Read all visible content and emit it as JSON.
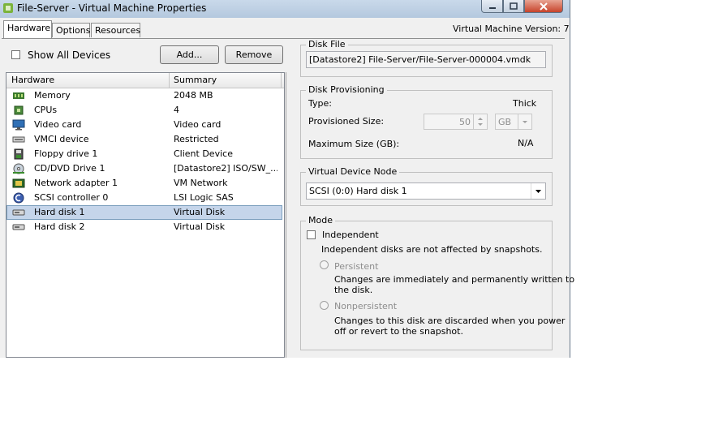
{
  "window": {
    "title": "File-Server - Virtual Machine Properties"
  },
  "tabs": [
    {
      "label": "Hardware",
      "active": true
    },
    {
      "label": "Options",
      "active": false
    },
    {
      "label": "Resources",
      "active": false
    }
  ],
  "vm_version": "Virtual Machine Version: 7",
  "show_all_devices": {
    "label": "Show All Devices",
    "checked": false
  },
  "buttons": {
    "add": "Add...",
    "remove": "Remove"
  },
  "hardware_table": {
    "columns": [
      "Hardware",
      "Summary"
    ],
    "rows": [
      {
        "name": "Memory",
        "summary": "2048 MB",
        "icon": "memory-icon"
      },
      {
        "name": "CPUs",
        "summary": "4",
        "icon": "cpu-icon"
      },
      {
        "name": "Video card",
        "summary": "Video card",
        "icon": "monitor-icon"
      },
      {
        "name": "VMCI device",
        "summary": "Restricted",
        "icon": "vmci-icon"
      },
      {
        "name": "Floppy drive 1",
        "summary": "Client Device",
        "icon": "floppy-icon"
      },
      {
        "name": "CD/DVD Drive 1",
        "summary": "[Datastore2] ISO/SW_...",
        "icon": "cd-icon"
      },
      {
        "name": "Network adapter 1",
        "summary": "VM Network",
        "icon": "network-icon"
      },
      {
        "name": "SCSI controller 0",
        "summary": "LSI Logic SAS",
        "icon": "scsi-icon"
      },
      {
        "name": "Hard disk 1",
        "summary": "Virtual Disk",
        "icon": "hard-disk-icon",
        "selected": true
      },
      {
        "name": "Hard disk 2",
        "summary": "Virtual Disk",
        "icon": "hard-disk-icon"
      }
    ]
  },
  "disk_file": {
    "label": "Disk File",
    "value": "[Datastore2] File-Server/File-Server-000004.vmdk"
  },
  "disk_provisioning": {
    "label": "Disk Provisioning",
    "type_label": "Type:",
    "type_value": "Thick",
    "provisioned_label": "Provisioned Size:",
    "provisioned_value": "50",
    "provisioned_unit": "GB",
    "max_label": "Maximum Size (GB):",
    "max_value": "N/A"
  },
  "virtual_device_node": {
    "label": "Virtual Device Node",
    "value": "SCSI (0:0) Hard disk 1"
  },
  "mode": {
    "label": "Mode",
    "independent_label": "Independent",
    "independent_checked": false,
    "independent_desc": "Independent disks are not affected by snapshots.",
    "persistent_label": "Persistent",
    "persistent_desc_1": "Changes are immediately and permanently written to",
    "persistent_desc_2": "the disk.",
    "nonpersistent_label": "Nonpersistent",
    "nonpersistent_desc_1": "Changes to this disk are discarded when you power",
    "nonpersistent_desc_2": "off or revert to the snapshot."
  }
}
